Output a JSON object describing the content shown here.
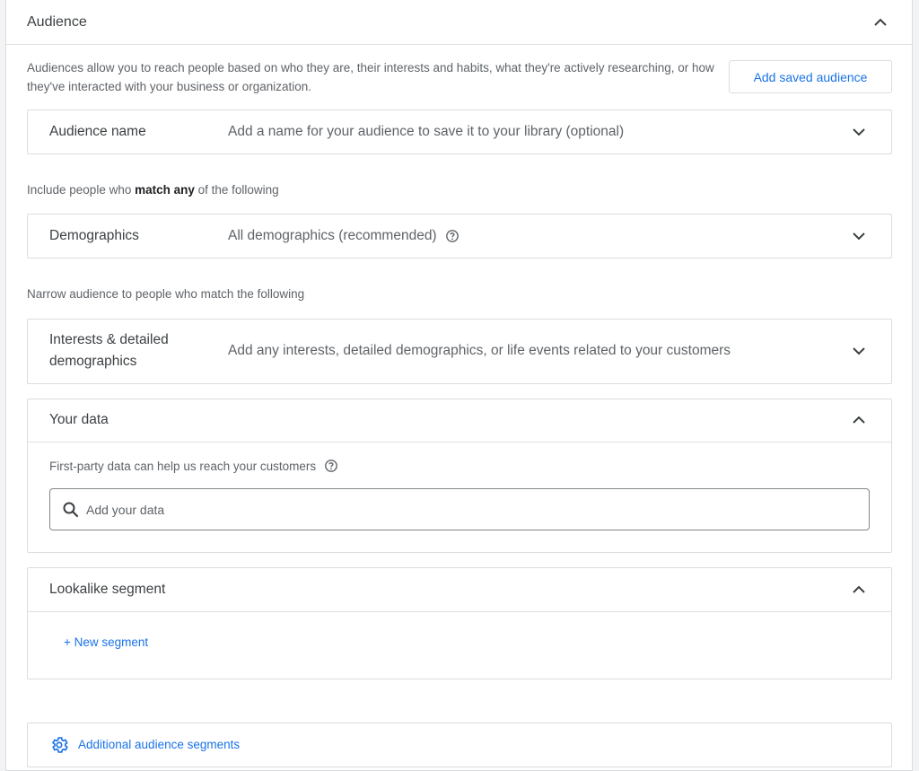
{
  "header": {
    "title": "Audience"
  },
  "intro": {
    "text": "Audiences allow you to reach people based on who they are, their interests and habits, what they're actively researching, or how they've interacted with your business or organization.",
    "add_saved_label": "Add saved audience"
  },
  "audience_name": {
    "label": "Audience name",
    "placeholder": "Add a name for your audience to save it to your library (optional)"
  },
  "include": {
    "prefix": "Include people who ",
    "emphasis": "match any",
    "suffix": " of the following"
  },
  "demographics": {
    "label": "Demographics",
    "value": "All demographics (recommended)"
  },
  "narrow": {
    "text": "Narrow audience to people who match the following"
  },
  "interests": {
    "label_line1": "Interests & detailed",
    "label_line2": "demographics",
    "value": "Add any interests, detailed demographics, or life events related to your customers"
  },
  "your_data": {
    "label": "Your data",
    "description": "First-party data can help us reach your customers",
    "search_placeholder": "Add your data"
  },
  "lookalike": {
    "label": "Lookalike segment",
    "new_segment_label": "+ New segment"
  },
  "additional": {
    "label": "Additional audience segments"
  },
  "colors": {
    "accent": "#1a73e8",
    "border": "#dadce0",
    "text": "#3c4043",
    "muted": "#5f6368"
  },
  "icons": {
    "collapse": "chevron-up-icon",
    "expand": "chevron-down-icon",
    "help": "help-circle-icon",
    "search": "search-icon",
    "settings": "gear-icon"
  }
}
